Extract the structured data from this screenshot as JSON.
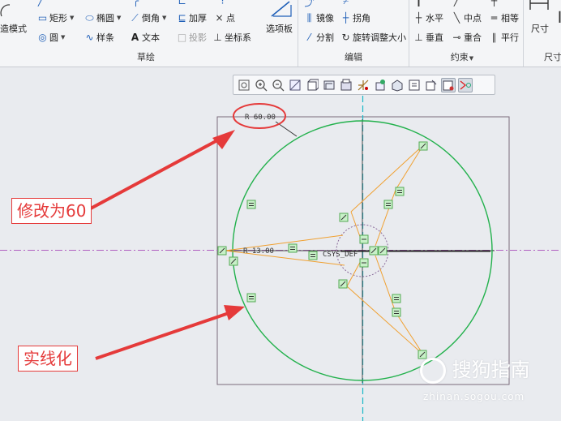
{
  "ribbon": {
    "sketch": {
      "group_label": "草绘",
      "left_tool": "造模式",
      "items": [
        {
          "id": "rectangle",
          "label": "矩形"
        },
        {
          "id": "ellipse",
          "label": "椭圆"
        },
        {
          "id": "chamfer",
          "label": "倒角"
        },
        {
          "id": "thicken",
          "label": "加厚"
        },
        {
          "id": "point",
          "label": "点"
        },
        {
          "id": "circle",
          "label": "圆"
        },
        {
          "id": "spline",
          "label": "样条"
        },
        {
          "id": "text",
          "label": "文本"
        },
        {
          "id": "project",
          "label": "投影"
        },
        {
          "id": "csys",
          "label": "坐标系"
        }
      ],
      "palette": "选项板"
    },
    "edit": {
      "group_label": "编辑",
      "items": [
        {
          "id": "mirror",
          "label": "镜像"
        },
        {
          "id": "corner",
          "label": "拐角"
        },
        {
          "id": "divide",
          "label": "分割"
        },
        {
          "id": "rotate_resize",
          "label": "旋转调整大小"
        }
      ]
    },
    "constrain": {
      "group_label": "约束",
      "items": [
        {
          "id": "horizontal",
          "label": "水平"
        },
        {
          "id": "midpoint",
          "label": "中点"
        },
        {
          "id": "equal",
          "label": "相等"
        },
        {
          "id": "perpendicular",
          "label": "垂直"
        },
        {
          "id": "coincident",
          "label": "重合"
        },
        {
          "id": "parallel",
          "label": "平行"
        }
      ]
    },
    "dimension": {
      "group_label": "尺寸",
      "label": "尺寸"
    }
  },
  "sketch": {
    "radius_dim": "R 60.00",
    "inner_dim": "R 13.00",
    "csys_label": "CSYS_DEF"
  },
  "annotations": {
    "callout_modify": "修改为60",
    "callout_solid": "实线化"
  },
  "watermark": {
    "brand": "搜狗指南",
    "url": "zhinan.sogou.com"
  },
  "colors": {
    "circle": "#22b14c",
    "construction_lines": "#f0a030",
    "centerline": "#1ab8c8",
    "annotation_red": "#e53a3a",
    "sketch_border": "#7b6b7b"
  }
}
